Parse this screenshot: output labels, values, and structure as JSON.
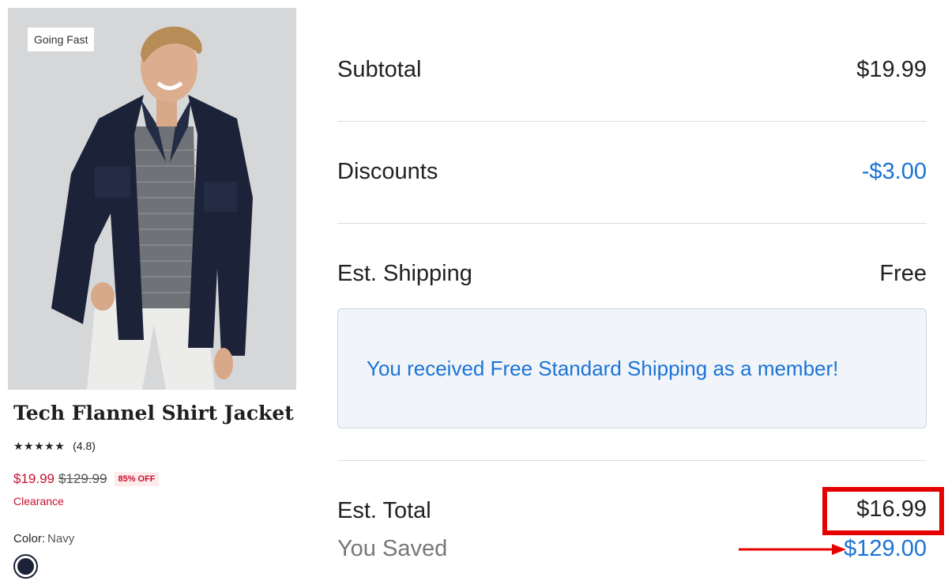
{
  "product": {
    "badge": "Going Fast",
    "title": "Tech Flannel Shirt Jacket",
    "stars": "★★★★★",
    "rating_count": "(4.8)",
    "price_sale": "$19.99",
    "price_original": "$129.99",
    "discount_badge": "85% OFF",
    "clearance_label": "Clearance",
    "color_label": "Color:",
    "color_value": "Navy",
    "swatch_color": "#1c2238",
    "sale_color": "#c8102e"
  },
  "summary": {
    "subtotal_label": "Subtotal",
    "subtotal_value": "$19.99",
    "discounts_label": "Discounts",
    "discounts_value": "-$3.00",
    "shipping_label": "Est. Shipping",
    "shipping_value": "Free",
    "shipping_notice": "You received Free Standard Shipping as a member!",
    "total_label": "Est. Total",
    "total_value": "$16.99",
    "saved_label": "You Saved",
    "saved_value": "$129.00",
    "accent_color": "#1b73d6"
  },
  "annotations": {
    "highlight_color": "#e50000",
    "arrow_icon": "arrow-right-icon"
  }
}
